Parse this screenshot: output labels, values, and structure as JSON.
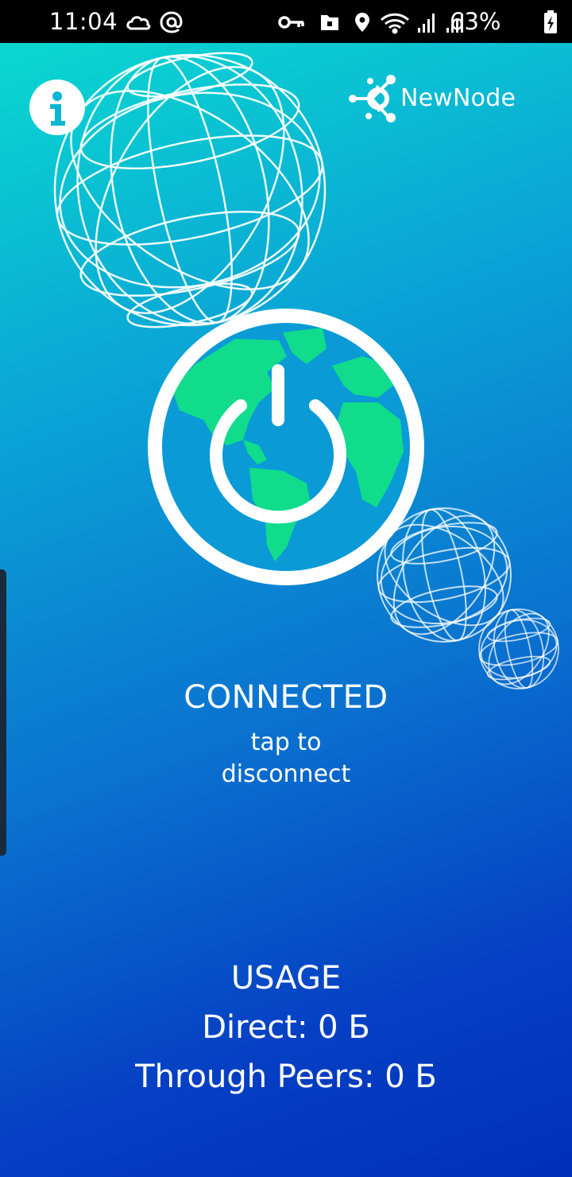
{
  "status_bar": {
    "time": "11:04",
    "battery_percent": "63%",
    "left_icons": [
      "cloud-icon",
      "at-icon"
    ],
    "right_icons": [
      "vpn-key-icon",
      "lock-folder-icon",
      "location-icon",
      "wifi-icon",
      "signal-icon",
      "signal-icon-2",
      "battery-icon"
    ]
  },
  "header": {
    "info_icon": "info-icon",
    "logo_text": "NewNode"
  },
  "connection": {
    "status": "CONNECTED",
    "hint_line1": "tap to",
    "hint_line2": "disconnect"
  },
  "usage": {
    "title": "USAGE",
    "direct": "Direct: 0 Б",
    "through_peers": "Through Peers: 0 Б"
  },
  "colors": {
    "gradient_top": "#0ad8d0",
    "gradient_bottom": "#0030b8",
    "ocean": "#0a9bd6",
    "land": "#10dc8c"
  }
}
